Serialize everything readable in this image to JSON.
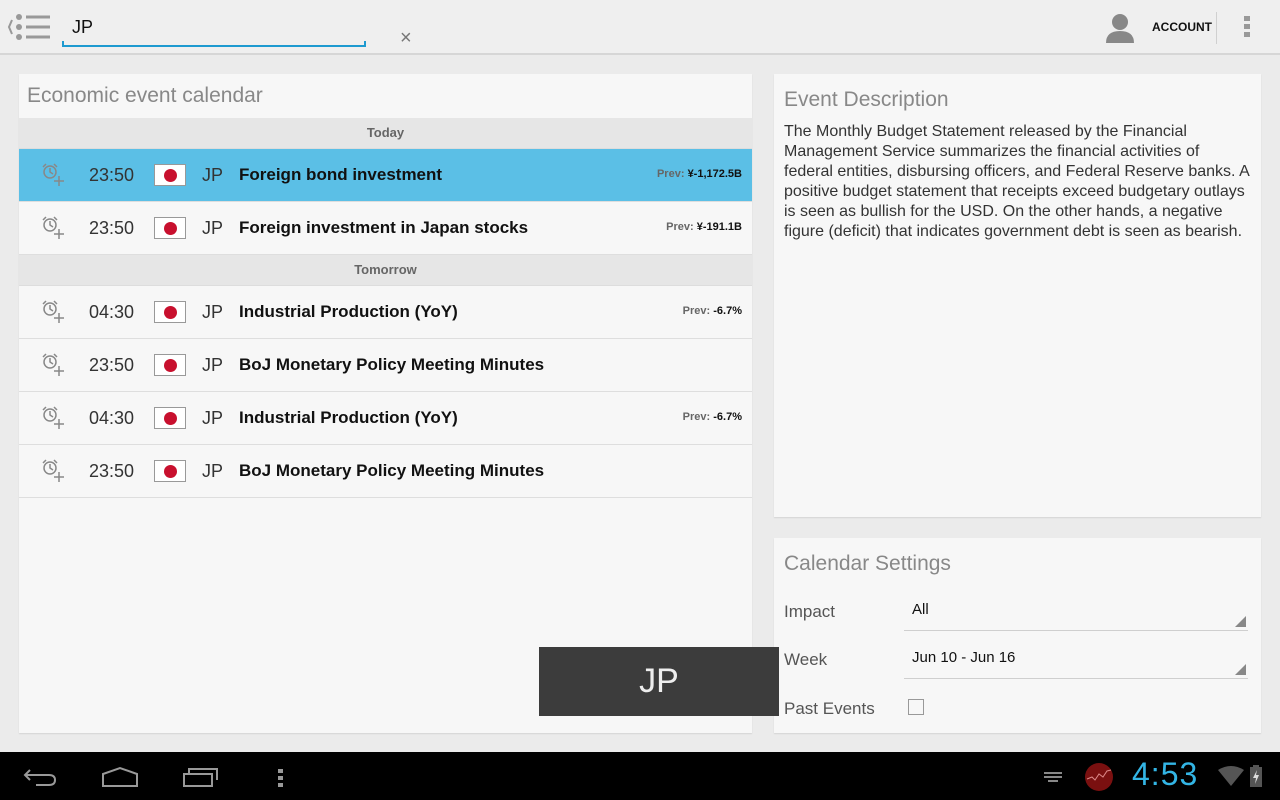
{
  "search": {
    "value": "JP"
  },
  "header": {
    "account_label": "ACCOUNT"
  },
  "calendar": {
    "title": "Economic event calendar",
    "sections": [
      {
        "label": "Today",
        "events": [
          {
            "time": "23:50",
            "country": "JP",
            "name": "Foreign bond investment",
            "prev_label": "Prev:",
            "prev_value": "¥-1,172.5B",
            "selected": true
          },
          {
            "time": "23:50",
            "country": "JP",
            "name": "Foreign investment in Japan stocks",
            "prev_label": "Prev:",
            "prev_value": "¥-191.1B"
          }
        ]
      },
      {
        "label": "Tomorrow",
        "events": [
          {
            "time": "04:30",
            "country": "JP",
            "name": "Industrial Production (YoY)",
            "prev_label": "Prev:",
            "prev_value": "-6.7%"
          },
          {
            "time": "23:50",
            "country": "JP",
            "name": "BoJ Monetary Policy Meeting Minutes"
          },
          {
            "time": "04:30",
            "country": "JP",
            "name": "Industrial Production (YoY)",
            "prev_label": "Prev:",
            "prev_value": "-6.7%"
          },
          {
            "time": "23:50",
            "country": "JP",
            "name": "BoJ Monetary Policy Meeting Minutes"
          }
        ]
      }
    ]
  },
  "description": {
    "title": "Event Description",
    "text": "The Monthly Budget Statement released by the Financial Management Service summarizes the financial activities of federal entities, disbursing officers, and Federal Reserve banks. A positive budget statement that receipts exceed budgetary outlays is seen as bullish for the USD. On the other hands, a negative figure (deficit) that indicates government debt is seen as bearish."
  },
  "settings": {
    "title": "Calendar Settings",
    "impact_label": "Impact",
    "impact_value": "All",
    "week_label": "Week",
    "week_value": "Jun 10 - Jun 16",
    "past_label": "Past Events",
    "past_checked": false
  },
  "toast": {
    "text": "JP"
  },
  "status": {
    "clock": "4:53"
  },
  "colors": {
    "accent": "#1e9ad0",
    "selected_row": "#5bbfe6",
    "clock": "#33b5e5"
  }
}
